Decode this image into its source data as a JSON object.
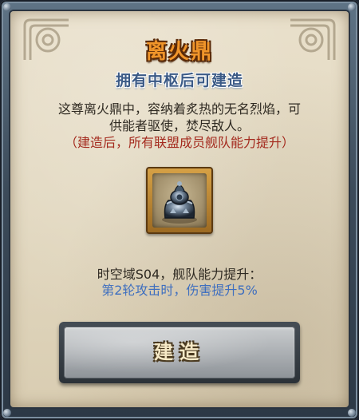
{
  "panel": {
    "title": "离火鼎",
    "subtitle": "拥有中枢后可建造",
    "description_line1": "这尊离火鼎中，容纳着炙热的无名烈焰，可",
    "description_line2": "供能者驱使，焚尽敌人。",
    "notice": "（建造后，所有联盟成员舰队能力提升）",
    "item_icon": "fire-cauldron-icon",
    "effect_title": "时空域S04，舰队能力提升：",
    "effect_detail": "第2轮攻击时，伤害提升5%",
    "build_label": "建造"
  },
  "colors": {
    "title": "#f0952a",
    "subtitle": "#3b5a86",
    "notice": "#a42a1e",
    "effect_detail": "#3f6fbf"
  }
}
